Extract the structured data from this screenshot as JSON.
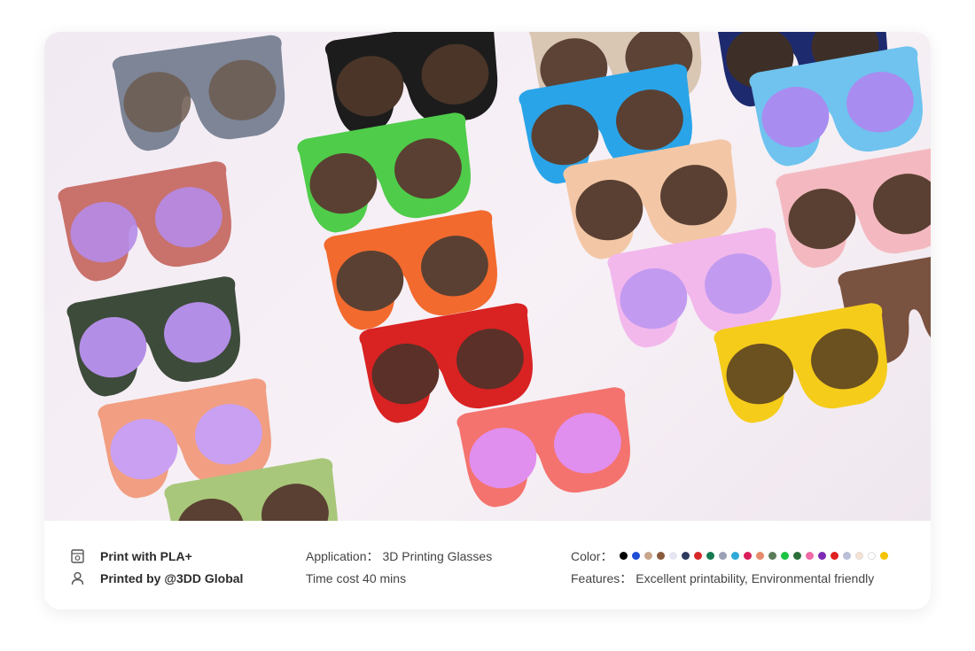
{
  "info": {
    "material": "Print with PLA+",
    "printed_by": "Printed by @3DD Global",
    "application_label": "Application",
    "application_value": "3D Printing Glasses",
    "time_cost": "Time cost 40 mins",
    "color_label": "Color",
    "features_label": "Features",
    "features_value": "Excellent printability, Environmental friendly",
    "colors": [
      "#000000",
      "#1f4fd6",
      "#c8a58b",
      "#8a5a3c",
      "#e6e6f2",
      "#2c3a5c",
      "#d62828",
      "#137a52",
      "#9aa0b5",
      "#2ea9d9",
      "#d81e5b",
      "#e58a6a",
      "#5b7a5a",
      "#1bc443",
      "#2b6e3a",
      "#f06aa6",
      "#7d2bb5",
      "#e02020",
      "#b9bfd6",
      "#f6e2d2",
      "#ffffff",
      "#f5c400"
    ]
  }
}
